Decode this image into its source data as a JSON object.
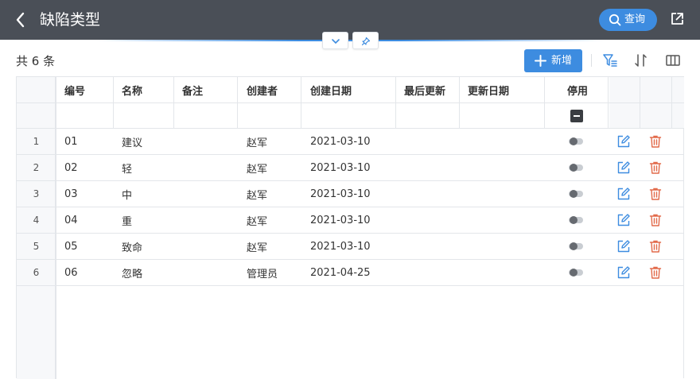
{
  "header": {
    "title": "缺陷类型",
    "query_label": "查询"
  },
  "toolbar": {
    "count_text": "共 6 条",
    "add_label": "新增"
  },
  "colors": {
    "header_bg": "#4a4f57",
    "accent": "#3d8ce0",
    "danger": "#e26a4a",
    "edit": "#3d8ce0"
  },
  "table": {
    "columns": [
      "编号",
      "名称",
      "备注",
      "创建者",
      "创建日期",
      "最后更新",
      "更新日期",
      "停用"
    ],
    "rows": [
      {
        "num": "1",
        "code": "01",
        "name": "建议",
        "note": "",
        "creator": "赵军",
        "created": "2021-03-10",
        "last_updater": "",
        "updated": "",
        "disabled": false
      },
      {
        "num": "2",
        "code": "02",
        "name": "轻",
        "note": "",
        "creator": "赵军",
        "created": "2021-03-10",
        "last_updater": "",
        "updated": "",
        "disabled": false
      },
      {
        "num": "3",
        "code": "03",
        "name": "中",
        "note": "",
        "creator": "赵军",
        "created": "2021-03-10",
        "last_updater": "",
        "updated": "",
        "disabled": false
      },
      {
        "num": "4",
        "code": "04",
        "name": "重",
        "note": "",
        "creator": "赵军",
        "created": "2021-03-10",
        "last_updater": "",
        "updated": "",
        "disabled": false
      },
      {
        "num": "5",
        "code": "05",
        "name": "致命",
        "note": "",
        "creator": "赵军",
        "created": "2021-03-10",
        "last_updater": "",
        "updated": "",
        "disabled": false
      },
      {
        "num": "6",
        "code": "06",
        "name": "忽略",
        "note": "",
        "creator": "管理员",
        "created": "2021-04-25",
        "last_updater": "",
        "updated": "",
        "disabled": false
      }
    ]
  },
  "icons": {
    "back": "chevron-left-icon",
    "query": "search-icon",
    "share": "share-icon",
    "collapse": "chevron-down-icon",
    "pin": "pin-icon",
    "add": "plus-icon",
    "filter": "filter-icon",
    "sort": "sort-icon",
    "columns": "columns-icon",
    "filter_disabled": "minus-square-icon",
    "edit": "edit-icon",
    "delete": "trash-icon"
  }
}
